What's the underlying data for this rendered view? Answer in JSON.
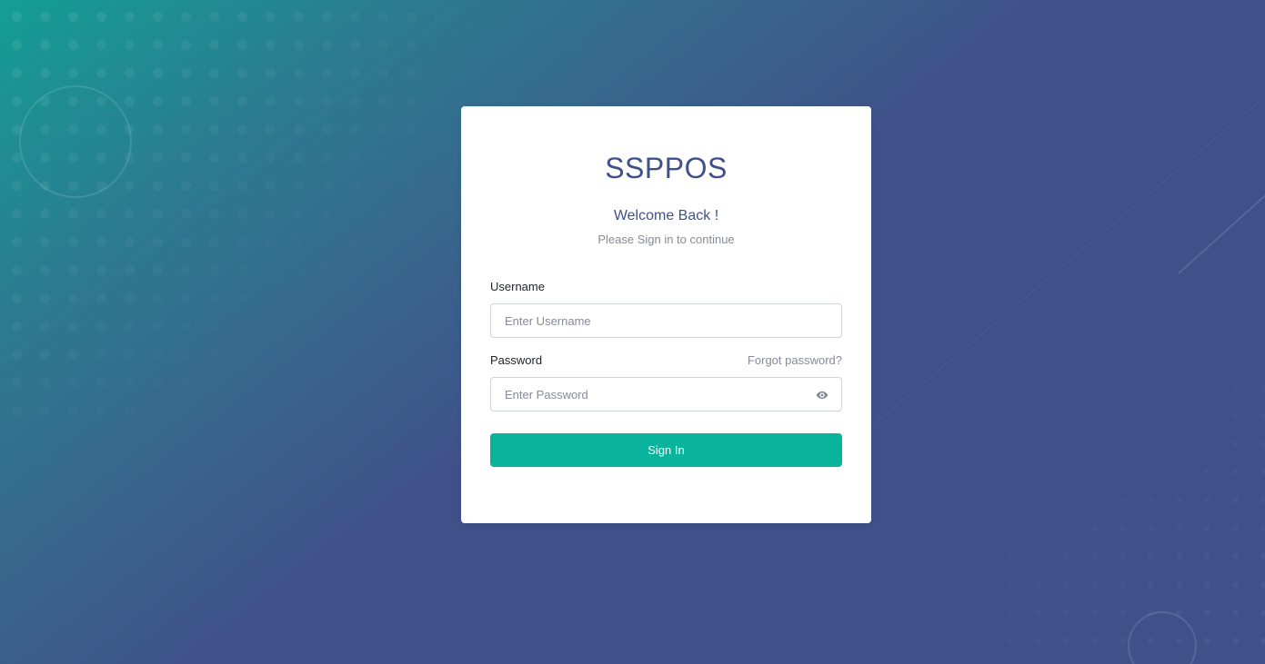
{
  "app": {
    "brand": "SSPPOS"
  },
  "login": {
    "welcome": "Welcome Back !",
    "subtitle": "Please Sign in to continue",
    "username_label": "Username",
    "username_placeholder": "Enter Username",
    "username_value": "",
    "password_label": "Password",
    "password_placeholder": "Enter Password",
    "password_value": "",
    "forgot_link": "Forgot password?",
    "signin_label": "Sign In"
  },
  "icons": {
    "password_toggle": "eye-icon"
  },
  "colors": {
    "primary": "#405189",
    "accent": "#0ab39c",
    "muted_text": "#878a99",
    "background_gradient_start": "#149e94",
    "background_gradient_end": "#405189"
  }
}
